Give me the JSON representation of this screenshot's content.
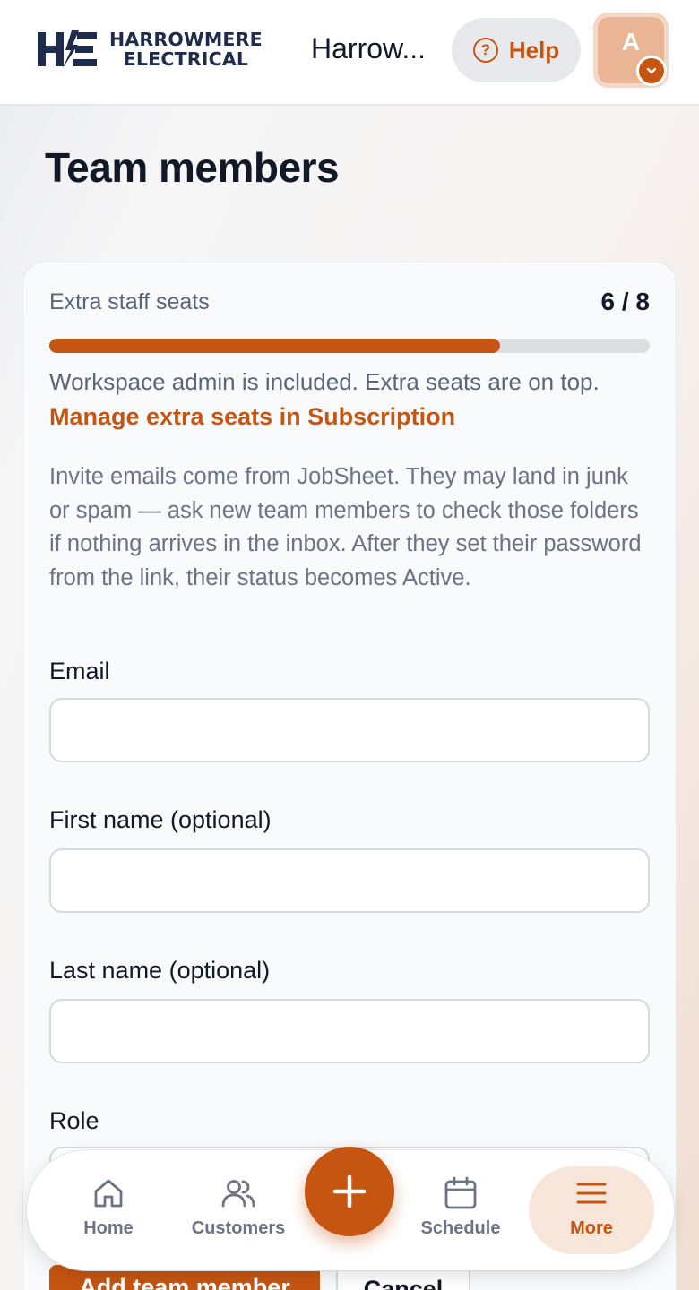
{
  "header": {
    "logo_line1": "HARROWMERE",
    "logo_line2": "ELECTRICAL",
    "workspace_name": "Harrow...",
    "help_label": "Help",
    "avatar_initial": "A"
  },
  "page": {
    "title": "Team members"
  },
  "seats": {
    "label": "Extra staff seats",
    "count_text": "6 / 8",
    "used": 6,
    "total": 8,
    "note": "Workspace admin is included. Extra seats are on top.",
    "manage_link": "Manage extra seats in Subscription"
  },
  "invite_info": "Invite emails come from JobSheet. They may land in junk or spam — ask new team members to check those folders if nothing arrives in the inbox. After they set their password from the link, their status becomes Active.",
  "form": {
    "email_label": "Email",
    "email_value": "",
    "first_name_label": "First name (optional)",
    "first_name_value": "",
    "last_name_label": "Last name (optional)",
    "last_name_value": "",
    "role_label": "Role",
    "submit_label": "Add team member",
    "cancel_label": "Cancel"
  },
  "nav": {
    "items": [
      {
        "label": "Home",
        "icon": "home-icon"
      },
      {
        "label": "Customers",
        "icon": "users-icon"
      },
      {
        "label": "Schedule",
        "icon": "calendar-icon"
      },
      {
        "label": "More",
        "icon": "menu-icon",
        "active": true
      }
    ],
    "fab_icon": "plus-icon"
  },
  "colors": {
    "accent": "#c65512",
    "brand_navy": "#1e2b4a",
    "text_muted": "#5b6577"
  }
}
